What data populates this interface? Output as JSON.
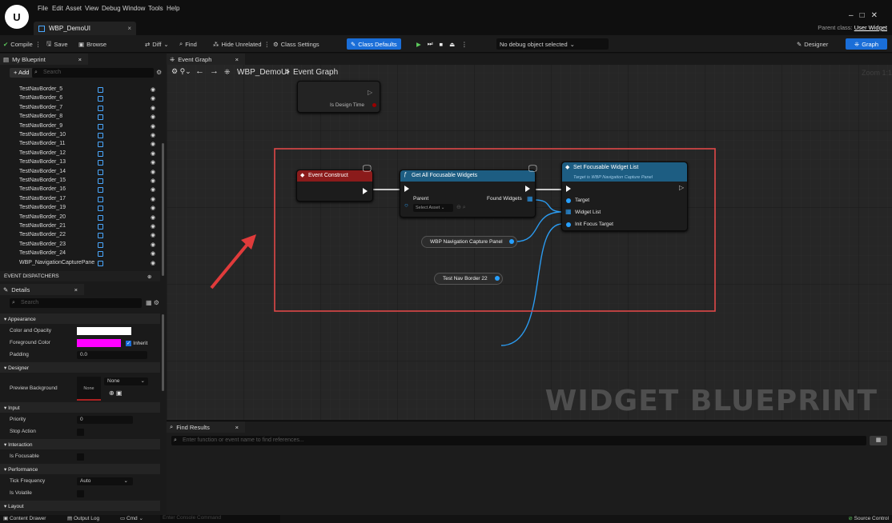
{
  "app": {
    "logo": "U",
    "menu": [
      "File",
      "Edit",
      "Asset",
      "View",
      "Debug",
      "Window",
      "Tools",
      "Help"
    ],
    "doc_tab": "WBP_DemoUI",
    "close_glyph": "×",
    "parent_class_label": "Parent class:",
    "parent_class_value": "User Widget",
    "window_controls": "–□✕"
  },
  "toolbar": {
    "compile": "Compile",
    "save": "Save",
    "browse": "Browse",
    "diff": "Diff",
    "find": "Find",
    "hide_unrelated": "Hide Unrelated",
    "class_settings": "Class Settings",
    "class_defaults": "Class Defaults",
    "debug_select": "No debug object selected",
    "designer": "Designer",
    "graph": "Graph"
  },
  "my_blueprint": {
    "tab": "My Blueprint",
    "add": "+ Add",
    "search_placeholder": "Search",
    "items": [
      "TestNavBorder_5",
      "TestNavBorder_6",
      "TestNavBorder_7",
      "TestNavBorder_8",
      "TestNavBorder_9",
      "TestNavBorder_10",
      "TestNavBorder_11",
      "TestNavBorder_12",
      "TestNavBorder_13",
      "TestNavBorder_14",
      "TestNavBorder_15",
      "TestNavBorder_16",
      "TestNavBorder_17",
      "TestNavBorder_19",
      "TestNavBorder_20",
      "TestNavBorder_21",
      "TestNavBorder_22",
      "TestNavBorder_23",
      "TestNavBorder_24",
      "WBP_NavigationCapturePane"
    ],
    "event_dispatchers": "EVENT DISPATCHERS"
  },
  "details": {
    "tab": "Details",
    "search_placeholder": "Search",
    "appearance": "Appearance",
    "color_opacity": "Color and Opacity",
    "foreground_color": "Foreground Color",
    "inherit": "Inherit",
    "padding": "Padding",
    "padding_value": "0.0",
    "designer": "Designer",
    "preview_background": "Preview Background",
    "none_select": "None",
    "none_thumb": "None",
    "input": "Input",
    "priority": "Priority",
    "priority_value": "0",
    "stop_action": "Stop Action",
    "interaction": "Interaction",
    "is_focusable": "Is Focusable",
    "performance": "Performance",
    "tick_frequency": "Tick Frequency",
    "tick_value": "Auto",
    "is_volatile": "Is Volatile",
    "layout": "Layout",
    "colors": {
      "white_swatch": "#ffffff",
      "magenta_swatch": "#ff00ff"
    }
  },
  "graph": {
    "tab": "Event Graph",
    "breadcrumb_bp": "WBP_DemoUI",
    "breadcrumb_sep": ">",
    "breadcrumb_graph": "Event Graph",
    "zoom": "Zoom 1:1",
    "watermark": "WIDGET BLUEPRINT",
    "is_design_time": "Is Design Time",
    "event_construct": "Event Construct",
    "get_all": "Get All Focusable Widgets",
    "parent": "Parent",
    "found_widgets": "Found Widgets",
    "select_asset": "Select Asset",
    "set_focusable": "Set Focusable Widget List",
    "target_desc": "Target is WBP Navigation Capture Panel",
    "target": "Target",
    "widget_list": "Widget List",
    "init_focus": "Init Focus Target",
    "var_panel": "WBP Navigation Capture Panel",
    "var_border": "Test Nav Border 22",
    "colors": {
      "event_head": "#8b1b1b",
      "func_head": "#1d5d82",
      "highlight_box": "#e04848",
      "arrow": "#e03b3b"
    }
  },
  "find_results": {
    "tab": "Find Results",
    "placeholder": "Enter function or event name to find references..."
  },
  "bottom": {
    "content_drawer": "Content Drawer",
    "output_log": "Output Log",
    "cmd": "Cmd",
    "console_placeholder": "Enter Console Command",
    "source_control": "Source Control"
  }
}
